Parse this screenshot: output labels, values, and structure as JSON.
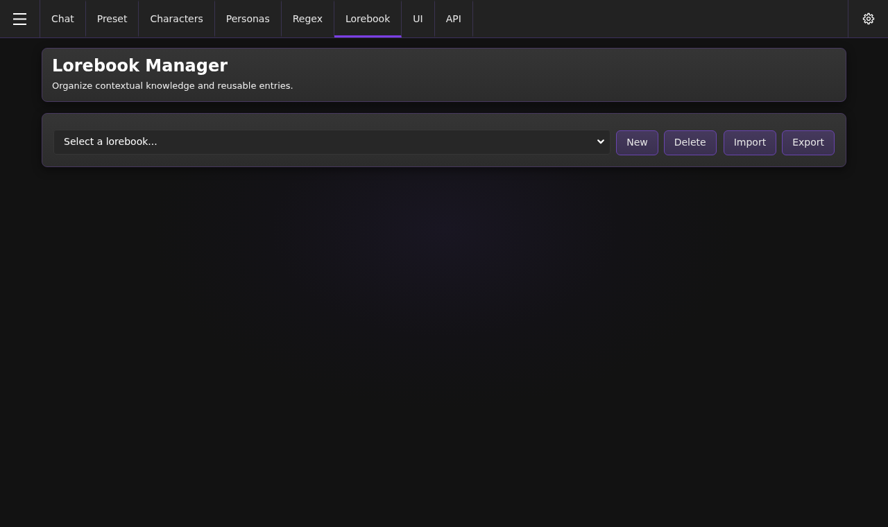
{
  "navbar": {
    "tabs": [
      {
        "label": "Chat",
        "selected": false
      },
      {
        "label": "Preset",
        "selected": false
      },
      {
        "label": "Characters",
        "selected": false
      },
      {
        "label": "Personas",
        "selected": false
      },
      {
        "label": "Regex",
        "selected": false
      },
      {
        "label": "Lorebook",
        "selected": true
      },
      {
        "label": "UI",
        "selected": false
      },
      {
        "label": "API",
        "selected": false
      }
    ]
  },
  "header": {
    "title": "Lorebook Manager",
    "subtitle": "Organize contextual knowledge and reusable entries."
  },
  "toolbar": {
    "lorebook_select": {
      "value": "Select a lorebook..."
    },
    "button_groups": [
      {
        "buttons": [
          "New",
          "Delete"
        ]
      },
      {
        "buttons": [
          "Import",
          "Export"
        ]
      }
    ]
  }
}
